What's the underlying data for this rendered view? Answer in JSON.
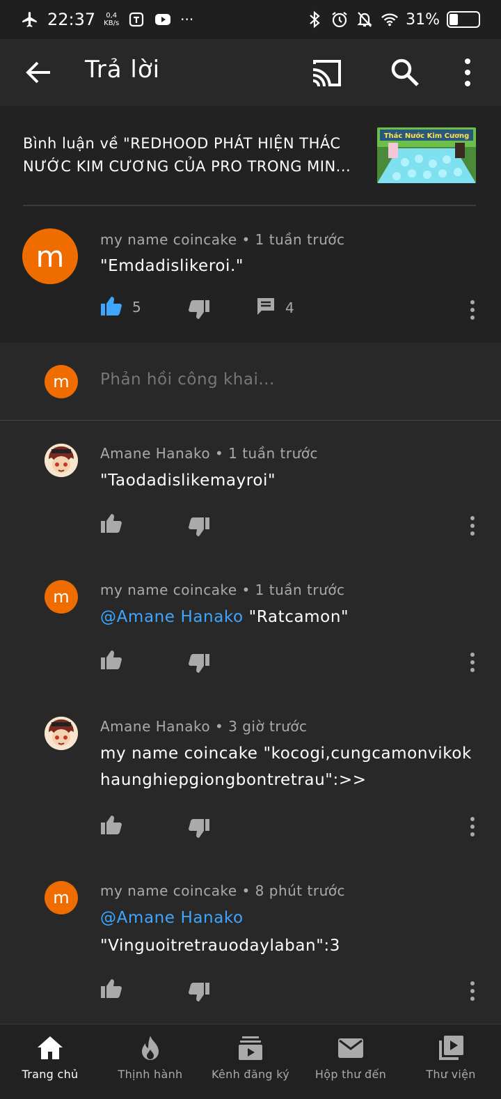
{
  "status_bar": {
    "time": "22:37",
    "net_speed_value": "0,4",
    "net_speed_unit": "KB/s",
    "more": "···",
    "battery": "31%",
    "battery_level": 0.31
  },
  "app_bar": {
    "title": "Trả lời"
  },
  "video": {
    "caption": "Bình luận về \"REDHOOD PHÁT HIỆN THÁC NƯỚC KIM CƯƠNG CỦA PRO TRONG MIN...",
    "thumbnail_text": "Thác Nước Kim Cương"
  },
  "main_comment": {
    "author": "my name coincake",
    "time": "1 tuần trước",
    "avatar_letter": "m",
    "text": "\"Emdadislikeroi.\"",
    "likes": "5",
    "replies": "4"
  },
  "reply_box": {
    "avatar_letter": "m",
    "placeholder": "Phản hồi công khai..."
  },
  "replies": [
    {
      "author": "Amane Hanako",
      "time": "1 tuần trước",
      "line1": "\"Taodadislikemayroi\""
    },
    {
      "author": "my name coincake",
      "time": "1 tuần trước",
      "avatar_letter": "m",
      "mention": "@Amane Hanako",
      "text": " \"Ratcamon\""
    },
    {
      "author": "Amane Hanako",
      "time": "3 giờ trước",
      "line1": "my name coincake \"kocogi,cungcamonvikok",
      "line2": "haunghiepgiongbontretrau\":>>"
    },
    {
      "author": "my name coincake",
      "time": "8 phút trước",
      "avatar_letter": "m",
      "mention": "@Amane Hanako",
      "line2": "\"Vinguoitretrauodaylaban\":3"
    }
  ],
  "bottom_nav": [
    {
      "label": "Trang chủ",
      "icon": "home-icon",
      "active": true
    },
    {
      "label": "Thịnh hành",
      "icon": "trending-icon"
    },
    {
      "label": "Kênh đăng ký",
      "icon": "subscriptions-icon"
    },
    {
      "label": "Hộp thư đến",
      "icon": "inbox-icon"
    },
    {
      "label": "Thư viện",
      "icon": "library-icon"
    }
  ],
  "colors": {
    "accent_blue": "#3ea6ff",
    "avatar_orange": "#ef6c00",
    "background": "#282828",
    "meta_gray": "#aaaaaa"
  }
}
